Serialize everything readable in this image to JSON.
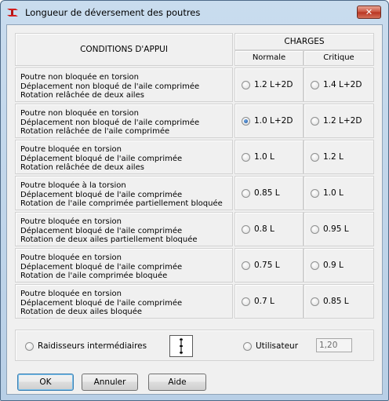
{
  "window": {
    "title": "Longueur de déversement des poutres",
    "close_label": "✕"
  },
  "table": {
    "header_conditions": "CONDITIONS D'APPUI",
    "header_charges": "CHARGES",
    "header_normale": "Normale",
    "header_critique": "Critique",
    "rows": [
      {
        "lines": [
          "Poutre non bloquée en torsion",
          "Déplacement non bloqué de l'aile comprimée",
          "Rotation relâchée de deux ailes"
        ],
        "normale": "1.2 L+2D",
        "critique": "1.4 L+2D",
        "selected": "none"
      },
      {
        "lines": [
          "Poutre non bloquée en torsion",
          "Déplacement non bloqué de l'aile comprimée",
          "Rotation relâchée de l'aile comprimée"
        ],
        "normale": "1.0 L+2D",
        "critique": "1.2 L+2D",
        "selected": "normale"
      },
      {
        "lines": [
          "Poutre bloquée en torsion",
          "Déplacement bloqué de l'aile comprimée",
          "Rotation relâchée de deux ailes"
        ],
        "normale": "1.0 L",
        "critique": "1.2 L",
        "selected": "none"
      },
      {
        "lines": [
          "Poutre bloquée à la torsion",
          "Déplacement bloqué de l'aile comprimée",
          "Rotation de l'aile comprimée partiellement bloquée"
        ],
        "normale": "0.85 L",
        "critique": "1.0 L",
        "selected": "none"
      },
      {
        "lines": [
          "Poutre bloquée en torsion",
          "Déplacement bloqué de l'aile comprimée",
          "Rotation de deux ailes partiellement bloquée"
        ],
        "normale": "0.8 L",
        "critique": "0.95 L",
        "selected": "none"
      },
      {
        "lines": [
          "Poutre bloquée en torsion",
          "Déplacement bloqué de l'aile comprimée",
          "Rotation de l'aile comprimée bloquée"
        ],
        "normale": "0.75 L",
        "critique": "0.9 L",
        "selected": "none"
      },
      {
        "lines": [
          "Poutre bloquée en torsion",
          "Déplacement bloqué de l'aile comprimée",
          "Rotation de deux ailes bloquée"
        ],
        "normale": "0.7 L",
        "critique": "0.85 L",
        "selected": "none"
      }
    ]
  },
  "bottom": {
    "raidisseurs_label": "Raidisseurs intermédiaires",
    "utilisateur_label": "Utilisateur",
    "utilisateur_value": "1,20"
  },
  "buttons": {
    "ok": "OK",
    "annuler": "Annuler",
    "aide": "Aide"
  }
}
